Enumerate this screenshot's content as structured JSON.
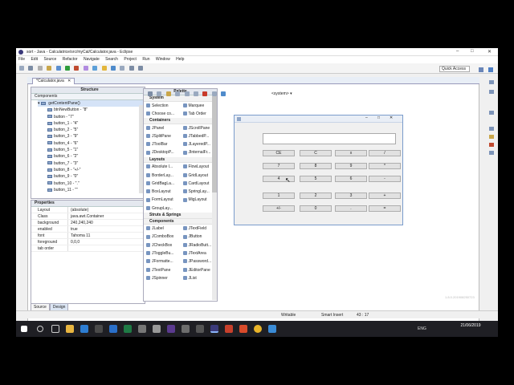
{
  "window": {
    "title": "sort - Java - Calculatrice/src/myCal/Calculator.java - Eclipse"
  },
  "menu": [
    "File",
    "Edit",
    "Source",
    "Refactor",
    "Navigate",
    "Search",
    "Project",
    "Run",
    "Window",
    "Help"
  ],
  "toolbar": {
    "quick_access": "Quick Access"
  },
  "editor": {
    "tab_label": "*Calculator.java"
  },
  "structure": {
    "title": "Structure",
    "components_label": "Components",
    "root": "getContentPane()",
    "items": [
      "btnNewButton - \"8\"",
      "button - \"7\"",
      "button_1 - \"4\"",
      "button_2 - \"5\"",
      "button_3 - \"9\"",
      "button_4 - \"6\"",
      "button_5 - \"1\"",
      "button_6 - \"2\"",
      "button_7 - \"3\"",
      "button_8 - \"+/-\"",
      "button_9 - \"0\"",
      "button_10 - \".\"",
      "button_11 - \"\""
    ]
  },
  "properties": {
    "title": "Properties",
    "rows": [
      {
        "key": "Layout",
        "value": "(absolute)"
      },
      {
        "key": "Class",
        "value": "java.awt.Container"
      },
      {
        "key": "background",
        "value": "240,240,240"
      },
      {
        "key": "enabled",
        "value": "true"
      },
      {
        "key": "font",
        "value": "Tahoma 11"
      },
      {
        "key": "foreground",
        "value": "0,0,0"
      },
      {
        "key": "tab order",
        "value": ""
      }
    ]
  },
  "bottom_tabs": [
    "Source",
    "Design"
  ],
  "palette": {
    "title": "Palette",
    "system": "<system>",
    "categories": [
      {
        "name": "System",
        "items": [
          "Selection",
          "Marquee",
          "Choose co...",
          "Tab Order"
        ]
      },
      {
        "name": "Containers",
        "items": [
          "JPanel",
          "JScrollPane",
          "JSplitPane",
          "JTabbedP...",
          "JToolBar",
          "JLayeredP...",
          "JDesktopP...",
          "JInternalFr..."
        ]
      },
      {
        "name": "Layouts",
        "items": [
          "Absolute l...",
          "FlowLayout",
          "BorderLay...",
          "GridLayout",
          "GridBagLa...",
          "CardLayout",
          "BoxLayout",
          "SpringLay...",
          "FormLayout",
          "MigLayout",
          "GroupLay..."
        ]
      },
      {
        "name": "Struts & Springs",
        "items": []
      },
      {
        "name": "Components",
        "items": [
          "JLabel",
          "JTextField",
          "JComboBox",
          "JButton",
          "JCheckBox",
          "JRadioButt...",
          "JToggleBu...",
          "JTextArea",
          "JFormatte...",
          "JPassword...",
          "JTextPane",
          "JEditorPane",
          "JSpinner",
          "JList"
        ]
      }
    ]
  },
  "calculator": {
    "rows": [
      [
        "CE",
        "C",
        "x",
        "/"
      ],
      [
        "7",
        "8",
        "9",
        "*"
      ],
      [
        "4",
        "5",
        "6",
        "-"
      ],
      [
        "1",
        "2",
        "3",
        "+"
      ],
      [
        "+/-",
        "0",
        ".",
        "="
      ]
    ]
  },
  "design_version": "1.8.0.201908250723",
  "status": {
    "writable": "Writable",
    "insert_mode": "Smart Insert",
    "position": "43 : 17"
  },
  "taskbar": {
    "tray_lang": "ENG",
    "time": "",
    "date": "21/06/2019"
  }
}
